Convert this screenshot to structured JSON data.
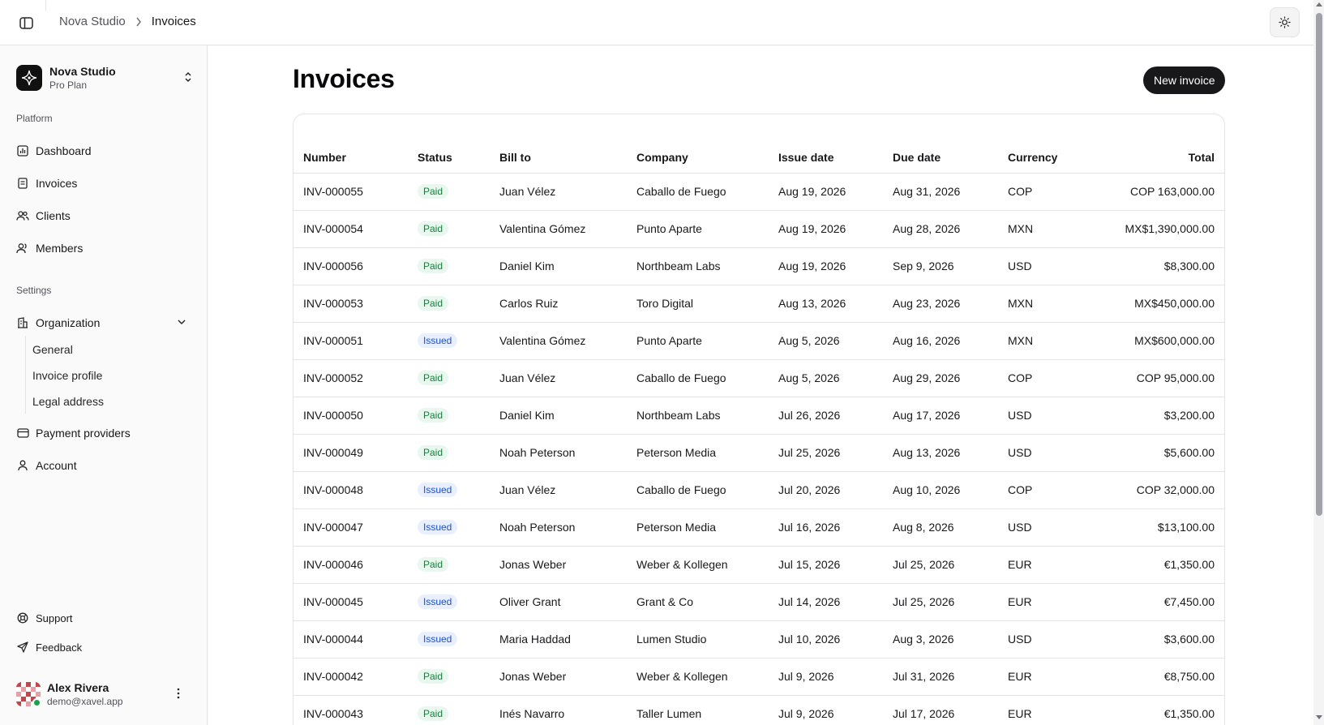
{
  "breadcrumb": {
    "org": "Nova Studio",
    "current": "Invoices"
  },
  "sidebar": {
    "org_name": "Nova Studio",
    "org_plan": "Pro Plan",
    "platform_label": "Platform",
    "platform_items": [
      {
        "label": "Dashboard",
        "icon": "dashboard-icon"
      },
      {
        "label": "Invoices",
        "icon": "invoice-icon"
      },
      {
        "label": "Clients",
        "icon": "clients-icon"
      },
      {
        "label": "Members",
        "icon": "members-icon"
      }
    ],
    "settings_label": "Settings",
    "organization_label": "Organization",
    "organization_sub": [
      "General",
      "Invoice profile",
      "Legal address"
    ],
    "payment_providers_label": "Payment providers",
    "account_label": "Account",
    "support_label": "Support",
    "feedback_label": "Feedback",
    "user_name": "Alex Rivera",
    "user_email": "demo@xavel.app"
  },
  "main": {
    "title": "Invoices",
    "new_button": "New invoice",
    "columns": [
      "Number",
      "Status",
      "Bill to",
      "Company",
      "Issue date",
      "Due date",
      "Currency",
      "Total"
    ],
    "rows": [
      [
        "INV-000055",
        "Paid",
        "Juan Vélez",
        "Caballo de Fuego",
        "Aug 19, 2026",
        "Aug 31, 2026",
        "COP",
        "COP 163,000.00"
      ],
      [
        "INV-000054",
        "Paid",
        "Valentina Gómez",
        "Punto Aparte",
        "Aug 19, 2026",
        "Aug 28, 2026",
        "MXN",
        "MX$1,390,000.00"
      ],
      [
        "INV-000056",
        "Paid",
        "Daniel Kim",
        "Northbeam Labs",
        "Aug 19, 2026",
        "Sep 9, 2026",
        "USD",
        "$8,300.00"
      ],
      [
        "INV-000053",
        "Paid",
        "Carlos Ruiz",
        "Toro Digital",
        "Aug 13, 2026",
        "Aug 23, 2026",
        "MXN",
        "MX$450,000.00"
      ],
      [
        "INV-000051",
        "Issued",
        "Valentina Gómez",
        "Punto Aparte",
        "Aug 5, 2026",
        "Aug 16, 2026",
        "MXN",
        "MX$600,000.00"
      ],
      [
        "INV-000052",
        "Paid",
        "Juan Vélez",
        "Caballo de Fuego",
        "Aug 5, 2026",
        "Aug 29, 2026",
        "COP",
        "COP 95,000.00"
      ],
      [
        "INV-000050",
        "Paid",
        "Daniel Kim",
        "Northbeam Labs",
        "Jul 26, 2026",
        "Aug 17, 2026",
        "USD",
        "$3,200.00"
      ],
      [
        "INV-000049",
        "Paid",
        "Noah Peterson",
        "Peterson Media",
        "Jul 25, 2026",
        "Aug 13, 2026",
        "USD",
        "$5,600.00"
      ],
      [
        "INV-000048",
        "Issued",
        "Juan Vélez",
        "Caballo de Fuego",
        "Jul 20, 2026",
        "Aug 10, 2026",
        "COP",
        "COP 32,000.00"
      ],
      [
        "INV-000047",
        "Issued",
        "Noah Peterson",
        "Peterson Media",
        "Jul 16, 2026",
        "Aug 8, 2026",
        "USD",
        "$13,100.00"
      ],
      [
        "INV-000046",
        "Paid",
        "Jonas Weber",
        "Weber & Kollegen",
        "Jul 15, 2026",
        "Jul 25, 2026",
        "EUR",
        "€1,350.00"
      ],
      [
        "INV-000045",
        "Issued",
        "Oliver Grant",
        "Grant & Co",
        "Jul 14, 2026",
        "Jul 25, 2026",
        "EUR",
        "€7,450.00"
      ],
      [
        "INV-000044",
        "Issued",
        "Maria Haddad",
        "Lumen Studio",
        "Jul 10, 2026",
        "Aug 3, 2026",
        "USD",
        "$3,600.00"
      ],
      [
        "INV-000042",
        "Paid",
        "Jonas Weber",
        "Weber & Kollegen",
        "Jul 9, 2026",
        "Jul 31, 2026",
        "EUR",
        "€8,750.00"
      ],
      [
        "INV-000043",
        "Paid",
        "Inés Navarro",
        "Taller Lumen",
        "Jul 9, 2026",
        "Jul 17, 2026",
        "EUR",
        "€1,350.00"
      ]
    ]
  },
  "colors": {
    "paid": "#15803d",
    "issued": "#1d4ed8",
    "primary": "#18181b",
    "online": "#16a34a"
  }
}
